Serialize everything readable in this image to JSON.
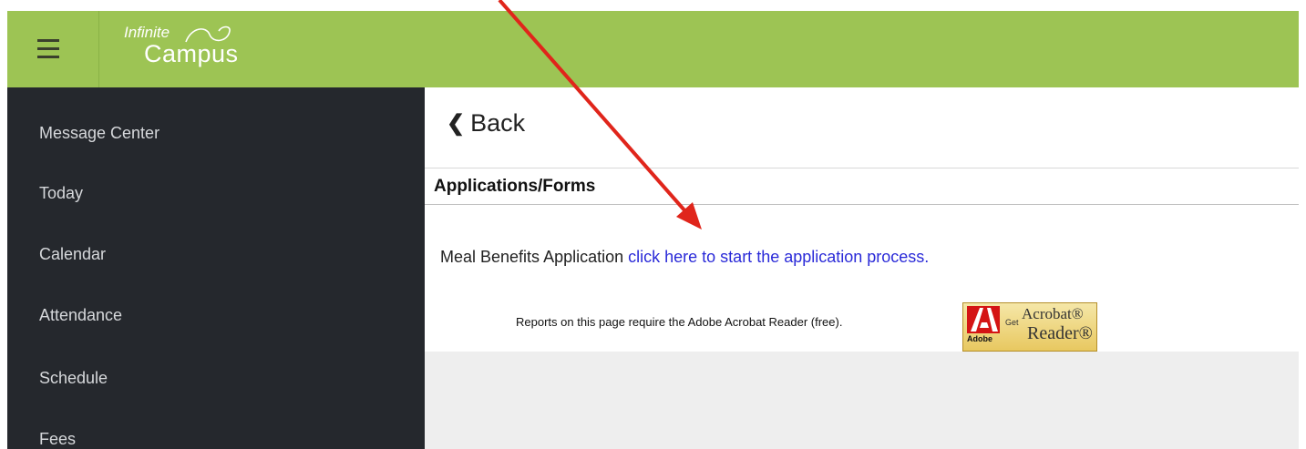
{
  "header": {
    "logo_small": "Infinite",
    "logo_big": "Campus",
    "bg_color": "#9dc454",
    "menu_icon": "hamburger-icon"
  },
  "sidebar": {
    "bg_color": "#25282d",
    "items": [
      {
        "label": "Message Center"
      },
      {
        "label": "Today"
      },
      {
        "label": "Calendar"
      },
      {
        "label": "Attendance"
      },
      {
        "label": "Schedule"
      },
      {
        "label": "Fees"
      }
    ]
  },
  "main": {
    "back_label": "Back",
    "section_title": "Applications/Forms",
    "meal_label": "Meal Benefits Application",
    "meal_link": "click here to start the application process.",
    "reports_note": "Reports on this page require the Adobe Acrobat Reader (free).",
    "acrobat_badge": {
      "adobe": "Adobe",
      "get": "Get",
      "acrobat": "Acrobat®",
      "reader": "Reader®"
    }
  },
  "annotation": {
    "arrow_color": "#e0251b"
  }
}
